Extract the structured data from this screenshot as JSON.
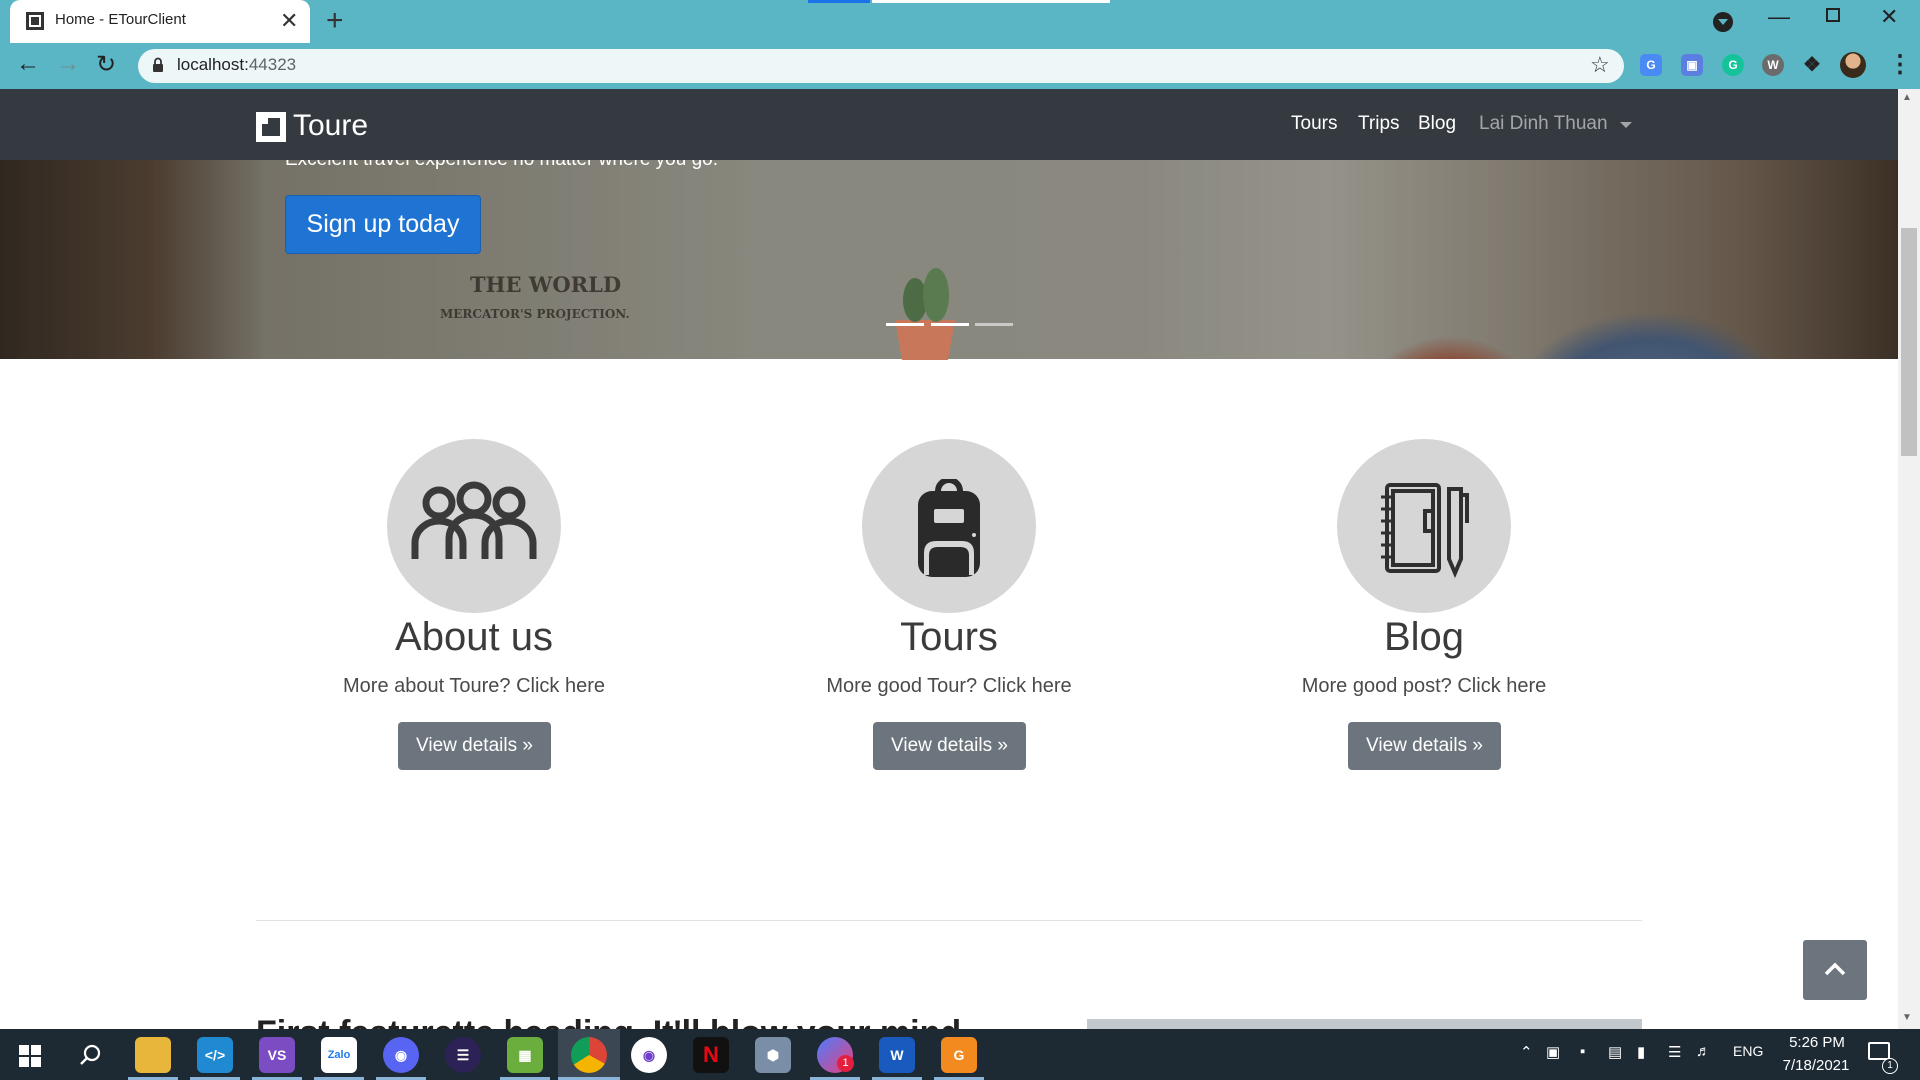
{
  "browser": {
    "tab_title": "Home - ETourClient",
    "url_host": "localhost:",
    "url_port": "44323",
    "new_tab": "+",
    "close_tab": "✕"
  },
  "navbar": {
    "brand": "Toure",
    "links": [
      "Tours",
      "Trips",
      "Blog"
    ],
    "user": "Lai Dinh Thuan"
  },
  "hero": {
    "tagline": "Excelent travel experience no matter where you go.",
    "map_title": "THE WORLD",
    "map_subtitle": "MERCATOR'S PROJECTION.",
    "signup_label": "Sign up today",
    "slides_active": 1,
    "slides_total": 3
  },
  "features": [
    {
      "icon": "people-icon",
      "title": "About us",
      "desc": "More about Toure? Click here",
      "button": "View details »"
    },
    {
      "icon": "backpack-icon",
      "title": "Tours",
      "desc": "More good Tour? Click here",
      "button": "View details »"
    },
    {
      "icon": "notebook-icon",
      "title": "Blog",
      "desc": "More good post? Click here",
      "button": "View details »"
    }
  ],
  "below_fold_heading": "First featurette heading. It'll blow your mind.",
  "taskbar": {
    "apps": [
      "File Explorer",
      "Visual Studio Code",
      "Visual Studio",
      "Zalo",
      "Discord",
      "Eclipse",
      "Greenshot",
      "Google Chrome",
      "GitHub Desktop",
      "Netflix",
      "App",
      "Messenger",
      "Word",
      "App"
    ],
    "language": "ENG",
    "time": "5:26 PM",
    "date": "7/18/2021",
    "notification_count": "1",
    "messenger_badge": "1"
  },
  "colors": {
    "chrome_frame": "#5ab6c5",
    "navbar_bg": "#343a40",
    "primary_button": "#1f74d3",
    "secondary_button": "#6c757d",
    "feature_circle": "#d6d6d6",
    "taskbar_bg": "#1e2a33"
  }
}
